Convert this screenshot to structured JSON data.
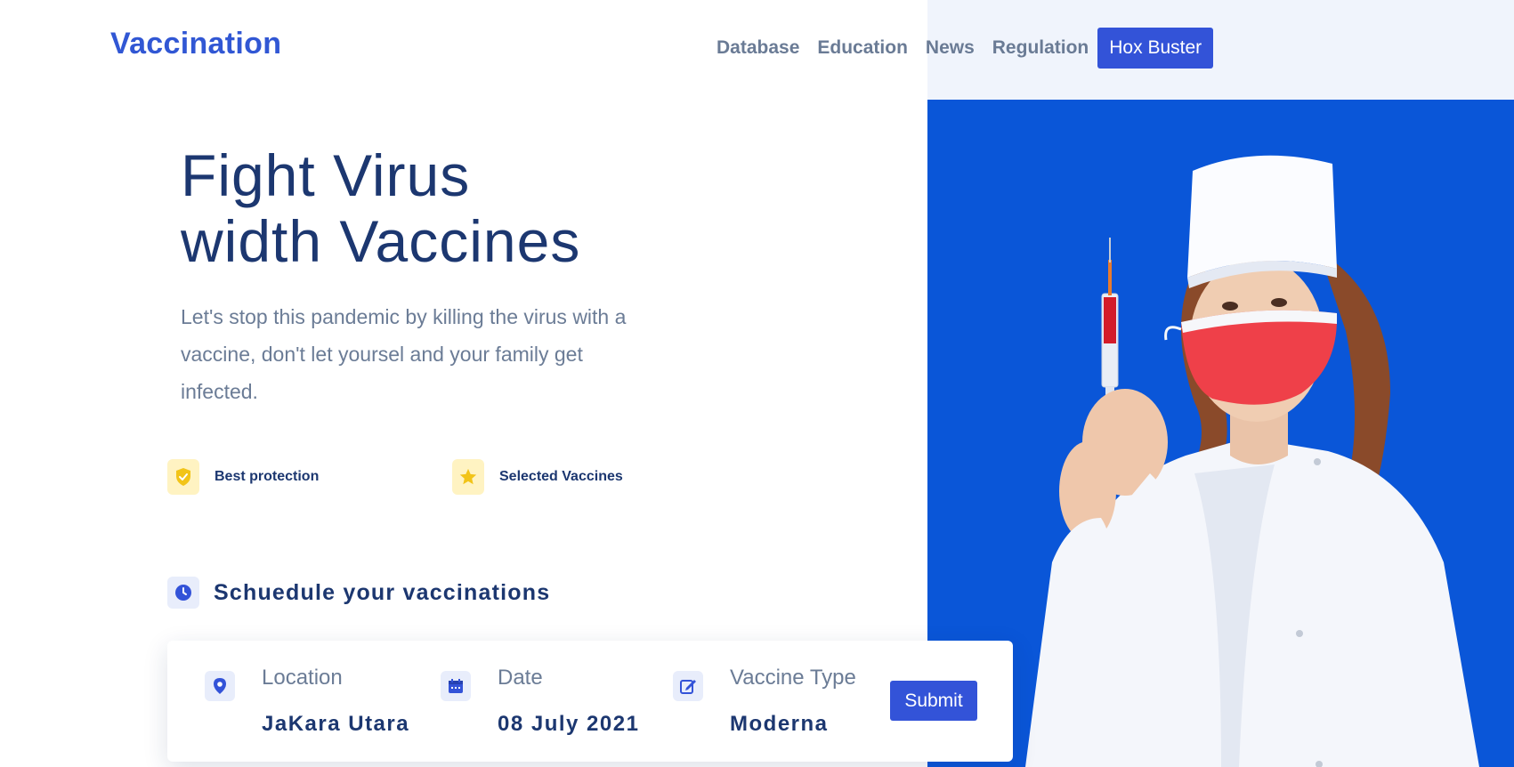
{
  "brand": {
    "logo": "Vaccination"
  },
  "nav": {
    "items": [
      "Database",
      "Education",
      "News",
      "Regulation"
    ],
    "cta": "Hox Buster"
  },
  "hero": {
    "headline_line1": "Fight Virus",
    "headline_line2": "width Vaccines",
    "lead": "Let's stop this pandemic by killing the virus with a vaccine, don't let yoursel and your family get infected.",
    "features": [
      {
        "icon": "shield-check-icon",
        "label": "Best protection"
      },
      {
        "icon": "star-icon",
        "label": "Selected Vaccines"
      }
    ]
  },
  "schedule": {
    "title": "Schuedule your vaccinations",
    "icon": "clock-icon",
    "fields": [
      {
        "icon": "map-pin-icon",
        "label": "Location",
        "value": "JaKara Utara"
      },
      {
        "icon": "calendar-icon",
        "label": "Date",
        "value": "08 July 2021"
      },
      {
        "icon": "edit-icon",
        "label": "Vaccine Type",
        "value": "Moderna"
      }
    ],
    "submit": "Submit"
  },
  "colors": {
    "brand": "#3157d4",
    "primary_button": "#3353d8",
    "heading": "#1c3770",
    "body_text": "#6b7c96",
    "photo_background": "#0a56d8",
    "feature_icon_bg": "#fff3c2",
    "feature_icon": "#f2c418"
  }
}
